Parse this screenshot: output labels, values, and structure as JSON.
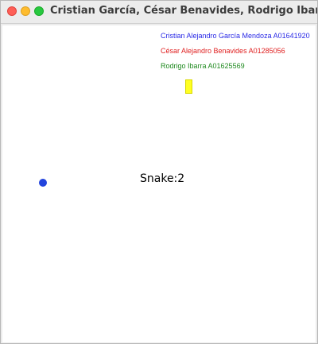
{
  "window": {
    "title": "Cristian García, César Benavides, Rodrigo Ibarra"
  },
  "colors": {
    "author_1": "#2a2ae6",
    "author_2": "#e02020",
    "author_3": "#1f8a1f",
    "food": "#ffff22",
    "snake": "#2244dd"
  },
  "game": {
    "authors": [
      {
        "text": "Cristian Alejandro García Mendoza A01641920"
      },
      {
        "text": "César Alejandro Benavides A01285056"
      },
      {
        "text": "Rodrigo Ibarra A01625569"
      }
    ],
    "score_label": "Snake:",
    "score_value": "2"
  }
}
